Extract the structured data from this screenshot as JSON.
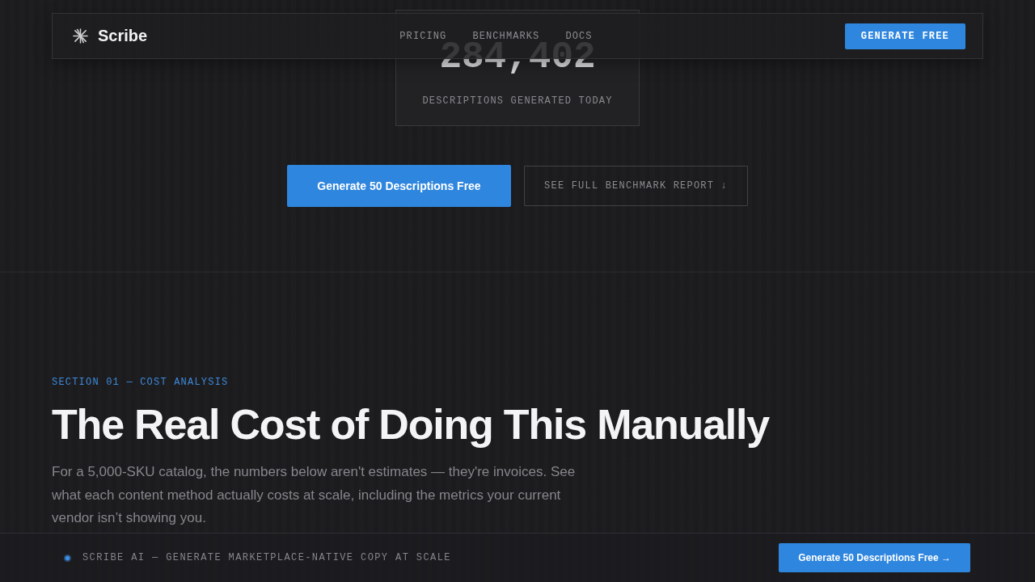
{
  "nav": {
    "logo": "Scribe",
    "links": [
      {
        "label": "PRICING"
      },
      {
        "label": "BENCHMARKS"
      },
      {
        "label": "DOCS"
      }
    ],
    "cta": "GENERATE FREE"
  },
  "hero": {
    "stat": {
      "value": "284,402",
      "label": "DESCRIPTIONS GENERATED TODAY"
    },
    "buttons": [
      {
        "kind": "primary",
        "label": "Generate 50 Descriptions Free"
      },
      {
        "kind": "outline",
        "label": "SEE FULL BENCHMARK REPORT ↓"
      }
    ]
  },
  "section": {
    "eyebrow": "SECTION 01 — COST ANALYSIS",
    "title": "The Real Cost of Doing This Manually",
    "body": "For a 5,000-SKU catalog, the numbers below aren't estimates — they're invoices. See what each content method actually costs at scale, including the metrics your current vendor isn’t showing you."
  },
  "bottom_bar": {
    "tagline": "SCRIBE AI — GENERATE MARKETPLACE-NATIVE COPY AT SCALE",
    "cta": "Generate 50 Descriptions Free →"
  }
}
